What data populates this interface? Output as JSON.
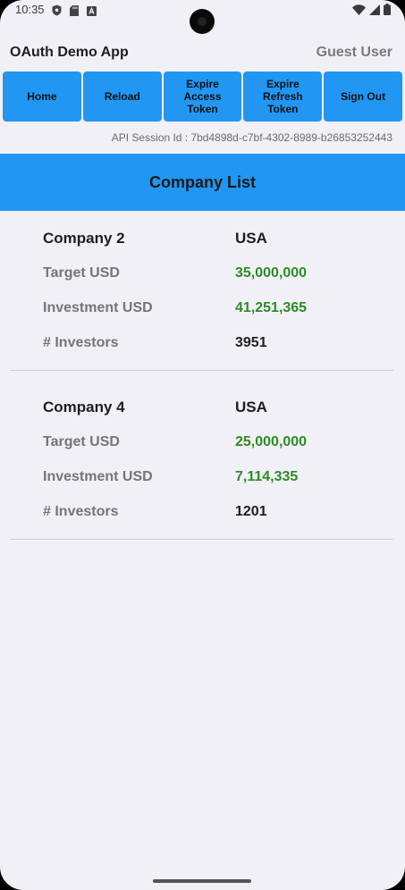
{
  "status_bar": {
    "time": "10:35",
    "left_icons": [
      "shield-icon",
      "sd-card-icon",
      "text-a-icon"
    ],
    "right_icons": [
      "wifi-icon",
      "signal-icon",
      "battery-icon"
    ]
  },
  "header": {
    "app_title": "OAuth Demo App",
    "user_name": "Guest User"
  },
  "toolbar": {
    "buttons": [
      {
        "label": "Home"
      },
      {
        "label": "Reload"
      },
      {
        "label": "Expire Access Token"
      },
      {
        "label": "Expire Refresh Token"
      },
      {
        "label": "Sign Out"
      }
    ]
  },
  "session": {
    "text": "API Session Id : 7bd4898d-c7bf-4302-8989-b26853252443"
  },
  "banner": {
    "title": "Company List"
  },
  "companies": [
    {
      "name": "Company 2",
      "country": "USA",
      "target_label": "Target USD",
      "target_value": "35,000,000",
      "investment_label": "Investment USD",
      "investment_value": "41,251,365",
      "investors_label": "# Investors",
      "investors_value": "3951"
    },
    {
      "name": "Company 4",
      "country": "USA",
      "target_label": "Target USD",
      "target_value": "25,000,000",
      "investment_label": "Investment USD",
      "investment_value": "7,114,335",
      "investors_label": "# Investors",
      "investors_value": "1201"
    }
  ],
  "colors": {
    "accent": "#2196f3",
    "money": "#2e8b25",
    "background": "#f2f0f7"
  }
}
